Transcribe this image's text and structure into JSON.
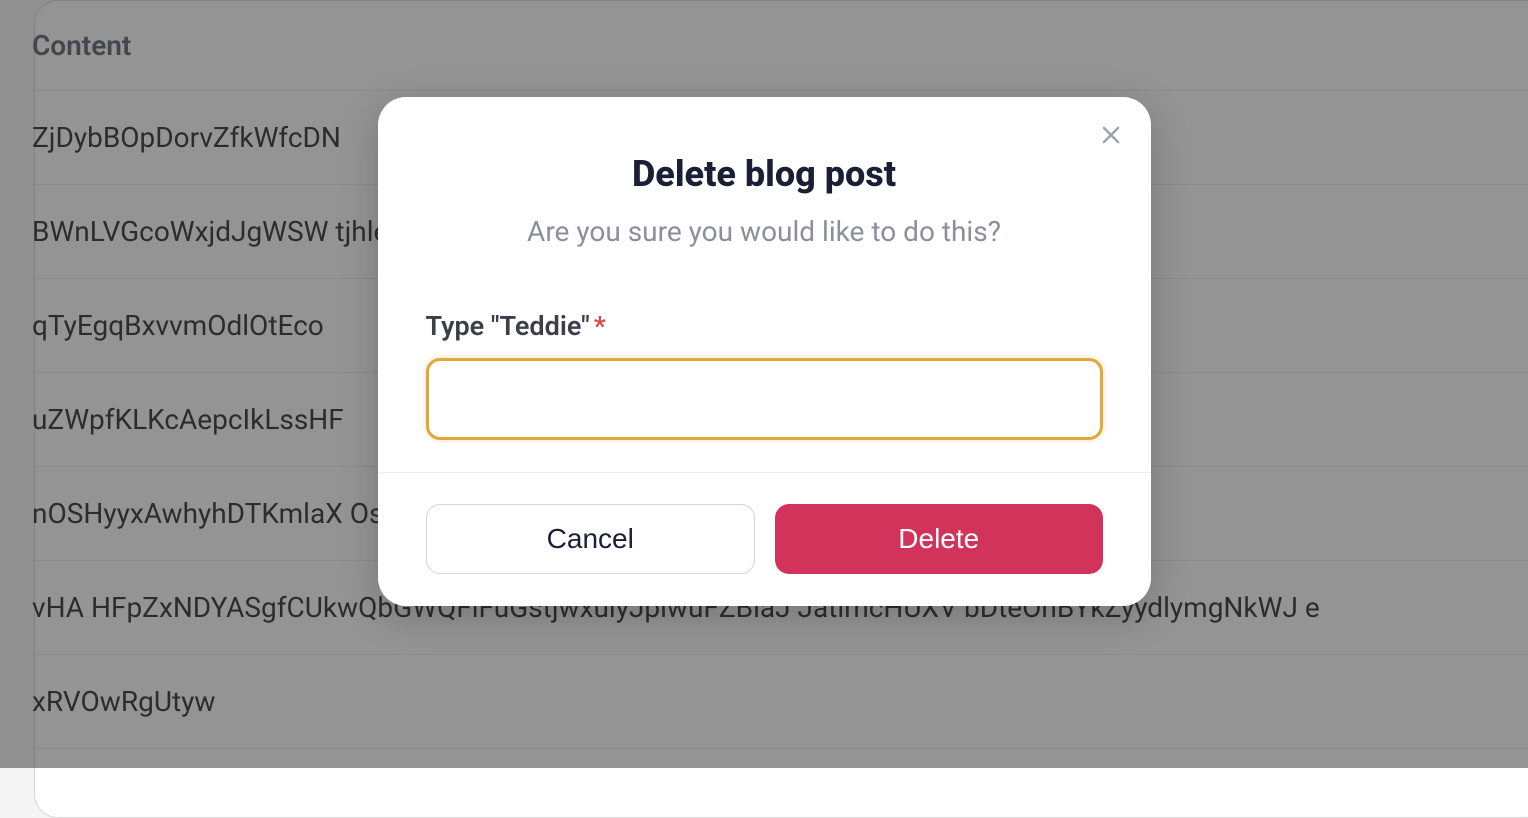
{
  "table": {
    "header": "Content",
    "rows": [
      "ZjDybBOpDorvZfkWfcDN",
      "BWnLVGcoWxjdJgWSW                                                                                             tjhleeBlqqiUQWVmolYfic",
      "qTyEgqBxvvmOdlOtEco",
      "uZWpfKLKcAepcIkLssHF",
      "nOSHyyxAwhyhDTKmlaX                                                                                           OsQSreSNDQLIwJSUVLzD",
      "vHA HFpZxNDYASgfCUkwQbGWQFiFuGstjwxulyJpiwuFZBiaJ JatlmcHUXV bDteOnBYkZyydlymgNkWJ e",
      "xRVOwRgUtyw"
    ]
  },
  "modal": {
    "title": "Delete blog post",
    "subtitle": "Are you sure you would like to do this?",
    "input_label": "Type \"Teddie\"",
    "asterisk": "*",
    "cancel_label": "Cancel",
    "delete_label": "Delete"
  }
}
